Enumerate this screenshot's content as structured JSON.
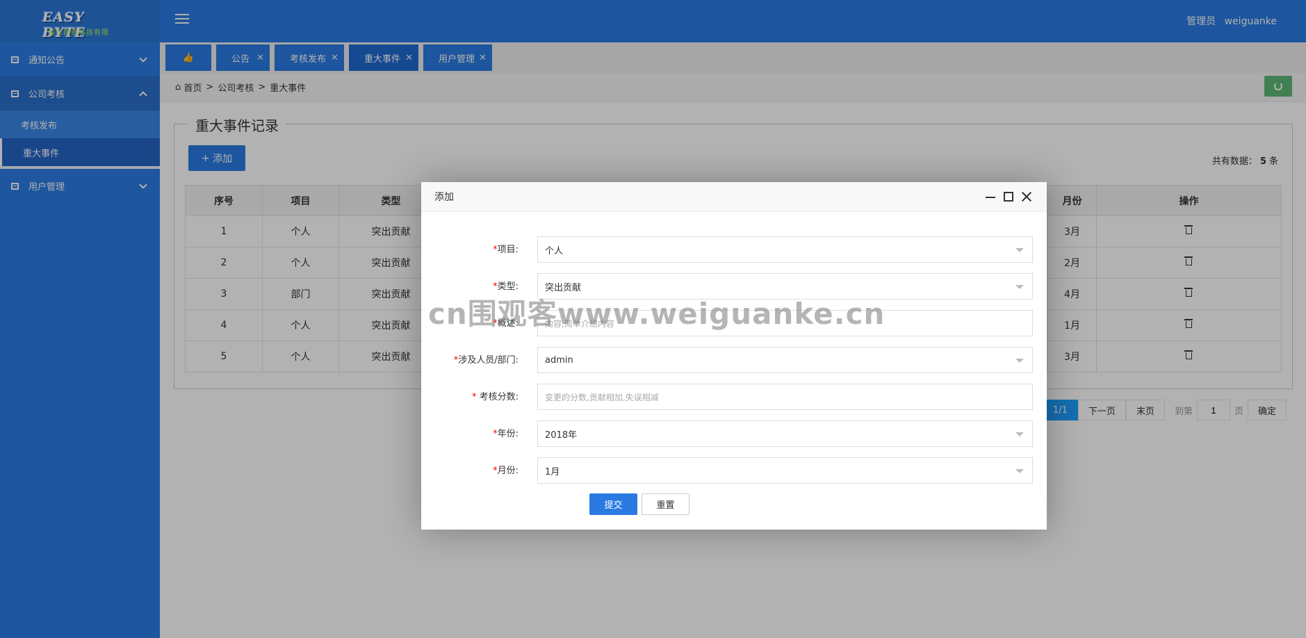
{
  "sidebar": {
    "logo_text": "EASY BYTE",
    "logo_sub": "易百网络科技有限",
    "groups": [
      {
        "label": "通知公告"
      },
      {
        "label": "公司考核",
        "children": [
          {
            "label": "考核发布"
          },
          {
            "label": "重大事件"
          }
        ]
      },
      {
        "label": "用户管理"
      }
    ]
  },
  "header": {
    "role": "管理员",
    "username": "weiguanke"
  },
  "tabs": [
    {
      "label": "公告"
    },
    {
      "label": "考核发布"
    },
    {
      "label": "重大事件"
    },
    {
      "label": "用户管理"
    }
  ],
  "breadcrumb": {
    "home": "首页",
    "level1": "公司考核",
    "level2": "重大事件"
  },
  "panel": {
    "title": "重大事件记录",
    "add_label": "添加",
    "total_prefix": "共有数据：",
    "total_count": "5",
    "total_suffix": "条"
  },
  "table": {
    "headers": [
      "序号",
      "项目",
      "类型",
      "月份",
      "操作"
    ],
    "rows": [
      {
        "no": "1",
        "item": "个人",
        "type": "突出贡献",
        "month": "3月"
      },
      {
        "no": "2",
        "item": "个人",
        "type": "突出贡献",
        "month": "2月"
      },
      {
        "no": "3",
        "item": "部门",
        "type": "突出贡献",
        "month": "4月"
      },
      {
        "no": "4",
        "item": "个人",
        "type": "突出贡献",
        "month": "1月"
      },
      {
        "no": "5",
        "item": "个人",
        "type": "突出贡献",
        "month": "3月"
      }
    ]
  },
  "pager": {
    "current": "1/1",
    "next": "下一页",
    "last": "末页",
    "goto": "到第",
    "page_value": "1",
    "unit": "页",
    "confirm": "确定"
  },
  "dialog": {
    "title": "添加",
    "fields": {
      "project": {
        "label": "项目:",
        "value": "个人"
      },
      "type": {
        "label": "类型:",
        "value": "突出贡献"
      },
      "desc": {
        "label": "概述:",
        "placeholder": "内容,简单介绍内容"
      },
      "people": {
        "label": "涉及人员/部门:",
        "value": "admin"
      },
      "score": {
        "label": "考核分数:",
        "placeholder": "变更的分数,贡献相加,失误相减"
      },
      "year": {
        "label": "年份:",
        "value": "2018年"
      },
      "month": {
        "label": "月份:",
        "value": "1月"
      }
    },
    "submit": "提交",
    "reset": "重置"
  },
  "watermark": "cn围观客www.weiguanke.cn",
  "colors": {
    "primary": "#2a7ae2",
    "sidebar": "#2b7de4",
    "refresh": "#5fb878",
    "required": "#ff0000"
  }
}
